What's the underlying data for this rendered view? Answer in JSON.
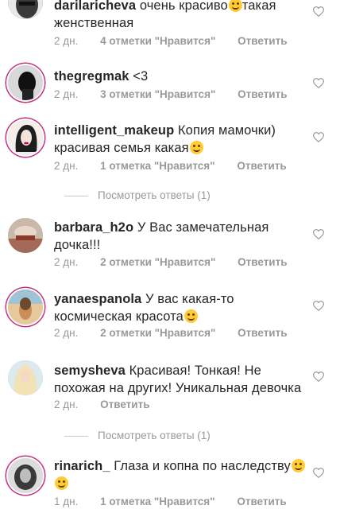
{
  "comments": [
    {
      "username": "darilaricheva",
      "text_before": "очень красиво",
      "text_after": "такая женственная",
      "time": "2 дн.",
      "likes": "4 отметки \"Нравится\"",
      "reply": "Ответить",
      "avatar_color": "#2b2b2b"
    },
    {
      "username": "thegregmak",
      "text_before": "<3",
      "text_after": "",
      "time": "2 дн.",
      "likes": "3 отметки \"Нравится\"",
      "reply": "Ответить",
      "avatar_color": "#1a1a1a"
    },
    {
      "username": "intelligent_makeup",
      "text_before": "Копия мамочки) красивая семья какая",
      "text_after": "",
      "time": "2 дн.",
      "likes": "1 отметка \"Нравится\"",
      "reply": "Ответить",
      "avatar_color": "#e9e2dc"
    },
    {
      "username": "barbara_h2o",
      "text_before": "У Вас замечательная дочка!!!",
      "text_after": "",
      "time": "2 дн.",
      "likes": "2 отметки \"Нравится\"",
      "reply": "Ответить",
      "avatar_color": "#b89a86"
    },
    {
      "username": "yanaespanola",
      "text_before": "У вас какая-то космическая красота",
      "text_after": "",
      "time": "2 дн.",
      "likes": "2 отметки \"Нравится\"",
      "reply": "Ответить",
      "avatar_color": "#d8b27a"
    },
    {
      "username": "semysheva",
      "text_before": "Красивая! Тонкая! Не похожая на других! Уникальная девочка",
      "text_after": "",
      "time": "2 дн.",
      "likes": "",
      "reply": "Ответить",
      "avatar_color": "#cfe0e8"
    },
    {
      "username": "rinarich_",
      "text_before": "Глаза и копна по наследству",
      "text_after": "",
      "time": "1 дн.",
      "likes": "1 отметка \"Нравится\"",
      "reply": "Ответить",
      "avatar_color": "#3a3a3a"
    }
  ],
  "view_replies_1": "Посмотреть ответы (1)",
  "view_replies_2": "Посмотреть ответы (1)"
}
